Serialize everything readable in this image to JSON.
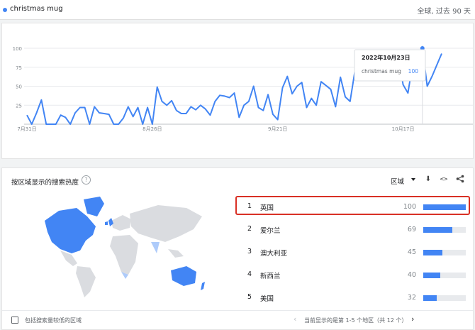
{
  "header": {
    "search_term": "christmas mug",
    "scope": "全球, 过去 90 天"
  },
  "chart_data": {
    "type": "line",
    "title": "",
    "y_ticks": [
      "100",
      "75",
      "50",
      "25"
    ],
    "ylim": [
      0,
      100
    ],
    "x_ticks": [
      "7月31日",
      "8月26日",
      "9月21日",
      "10月17日"
    ],
    "x_tick_indices": [
      0,
      26,
      52,
      78
    ],
    "series": [
      {
        "name": "christmas mug",
        "values": [
          12,
          0,
          15,
          32,
          0,
          0,
          0,
          12,
          9,
          0,
          15,
          22,
          22,
          0,
          23,
          15,
          14,
          13,
          0,
          0,
          8,
          23,
          10,
          22,
          0,
          22,
          0,
          49,
          30,
          25,
          31,
          18,
          14,
          14,
          23,
          19,
          25,
          20,
          12,
          30,
          38,
          37,
          35,
          41,
          9,
          25,
          30,
          50,
          22,
          18,
          39,
          13,
          6,
          48,
          63,
          40,
          50,
          55,
          22,
          34,
          25,
          56,
          51,
          46,
          23,
          62,
          36,
          30,
          70,
          74,
          80,
          84,
          83,
          87,
          90,
          92,
          94,
          90,
          52,
          41,
          80,
          70,
          100,
          50,
          63,
          78,
          93
        ]
      }
    ],
    "tooltip": {
      "date": "2022年10月23日",
      "series_label": "christmas mug",
      "value": "100",
      "point_index": 82
    }
  },
  "region_section": {
    "title": "按区域显示的搜索热度",
    "help_icon": "?",
    "region_select": "区域",
    "icons": [
      "download-icon",
      "embed-icon",
      "share-icon"
    ],
    "rankings": [
      {
        "rank": "1",
        "name": "英国",
        "value": "100",
        "score": 100
      },
      {
        "rank": "2",
        "name": "爱尔兰",
        "value": "69",
        "score": 69
      },
      {
        "rank": "3",
        "name": "澳大利亚",
        "value": "45",
        "score": 45
      },
      {
        "rank": "4",
        "name": "新西兰",
        "value": "40",
        "score": 40
      },
      {
        "rank": "5",
        "name": "美国",
        "value": "32",
        "score": 32
      }
    ],
    "checkbox_label": "包括搜索量较低的区域",
    "pager_text": "当前显示的是第 1-5 个地区（共 12 个）"
  },
  "colors": {
    "accent": "#4285f4",
    "highlight": "#d93025",
    "map_land": "#dadce0",
    "map_high": "#4285f4",
    "map_mid": "#8ab4f8",
    "map_low": "#aecbfa"
  }
}
